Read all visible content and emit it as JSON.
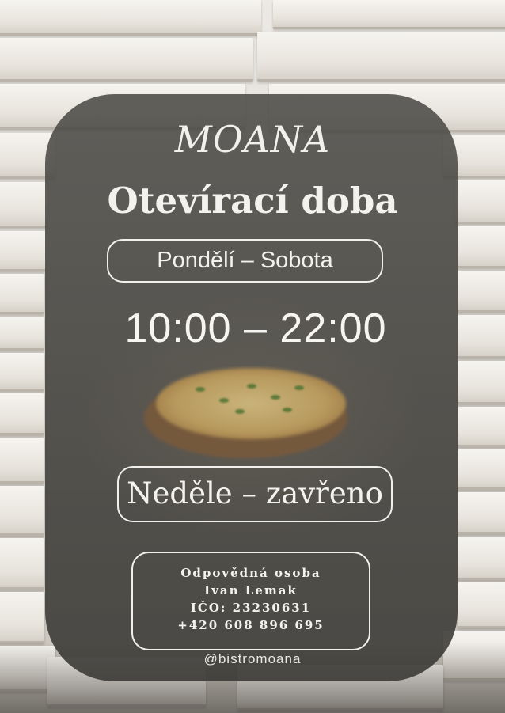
{
  "poster": {
    "logo": "MOANA",
    "heading": "Otevírací doba",
    "weekdays_label": "Pondělí – Sobota",
    "weekday_hours": "10:00 – 22:00",
    "sunday_label": "Neděle – zavřeno",
    "contact": {
      "line1": "Odpovědná osoba",
      "line2": "Ivan Lemak",
      "line3": "IČO: 23230631",
      "line4": "+420 608 896 695"
    },
    "social_handle": "@bistromoana"
  },
  "colors": {
    "card_overlay": "#484642",
    "text": "#f4f2ee",
    "background_boxes": "#ece9e4"
  }
}
